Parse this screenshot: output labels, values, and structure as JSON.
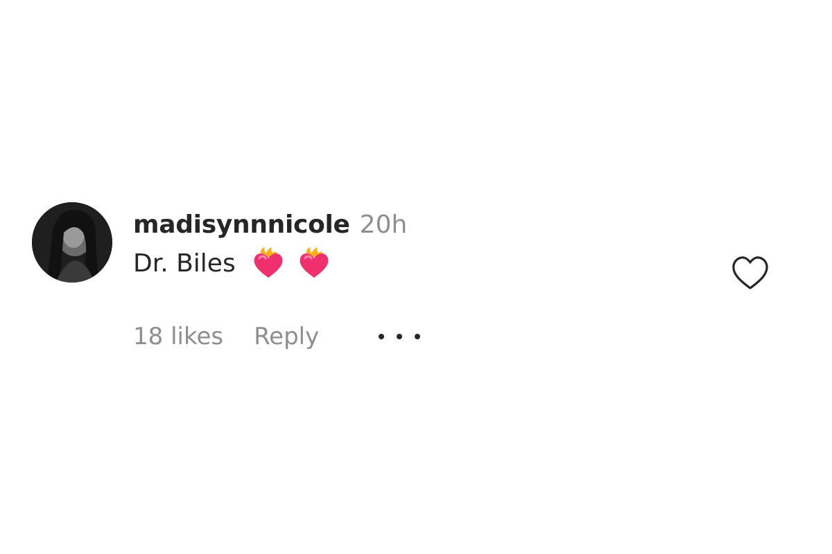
{
  "comment": {
    "username": "madisynnnicole",
    "timestamp": "20h",
    "text": "Dr. Biles",
    "emojis": [
      "heart-on-fire-emoji",
      "heart-on-fire-emoji"
    ],
    "likes_label": "18 likes",
    "reply_label": "Reply",
    "more_icon": "more-options-icon",
    "like_icon": "heart-outline-icon"
  },
  "colors": {
    "primary_text": "#262626",
    "secondary_text": "#8e8e8e",
    "emoji_pink": "#f0306e",
    "emoji_flame": "#ffb020"
  }
}
